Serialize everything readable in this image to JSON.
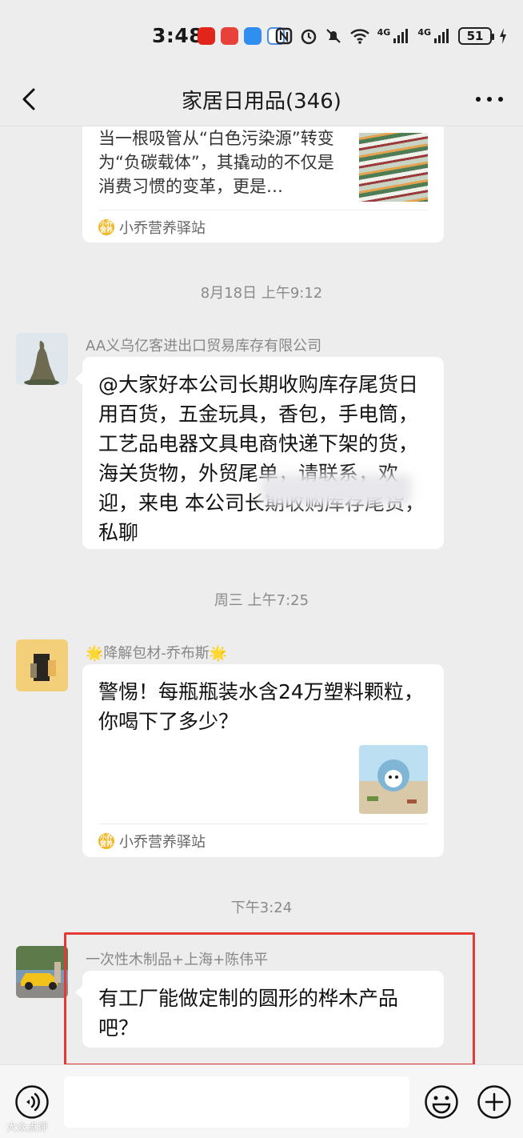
{
  "status_bar": {
    "time": "3:48",
    "network_1": "4G",
    "network_2": "4G",
    "battery": "51"
  },
  "nav": {
    "title": "家居日用品(346)",
    "back_icon": "chevron-left-icon",
    "more_icon": "more-dots-icon"
  },
  "messages": {
    "top_card": {
      "text": "当一根吸管从“白色污染源”转变为“负碳载体”，其撬动的不仅是消费习惯的变革，更是…",
      "source_icon_text": "小乔 营养",
      "source": "小乔营养驿站"
    },
    "ts1": "8月18日 上午9:12",
    "msg1": {
      "sender": "AA义乌亿客进出口贸易库存有限公司",
      "text": "@大家好本公司长期收购库存尾货日用百货，五金玩具，香包，手电筒，工艺品电器文具电商快递下架的货，海关货物，外贸尾单，请联系，欢迎，来电 本公司长期收购库存尾货，私聊"
    },
    "ts2": "周三 上午7:25",
    "msg2": {
      "sender": "🌟降解包材-乔布斯🌟",
      "card_title": "警惕！每瓶瓶装水含24万塑料颗粒，你喝下了多少？",
      "source_icon_text": "小乔 营养",
      "source": "小乔营养驿站"
    },
    "ts3": "下午3:24",
    "msg3": {
      "sender": "一次性木制品+上海+陈伟平",
      "text": "有工厂能做定制的圆形的桦木产品吧？"
    }
  },
  "input_bar": {
    "voice_icon": "voice-icon",
    "emoji_icon": "emoji-icon",
    "add_icon": "plus-icon"
  },
  "watermark": "大众点评",
  "colors": {
    "background": "#ededed",
    "bubble": "#ffffff",
    "highlight": "#e53935",
    "source_icon": "#f0b623"
  }
}
